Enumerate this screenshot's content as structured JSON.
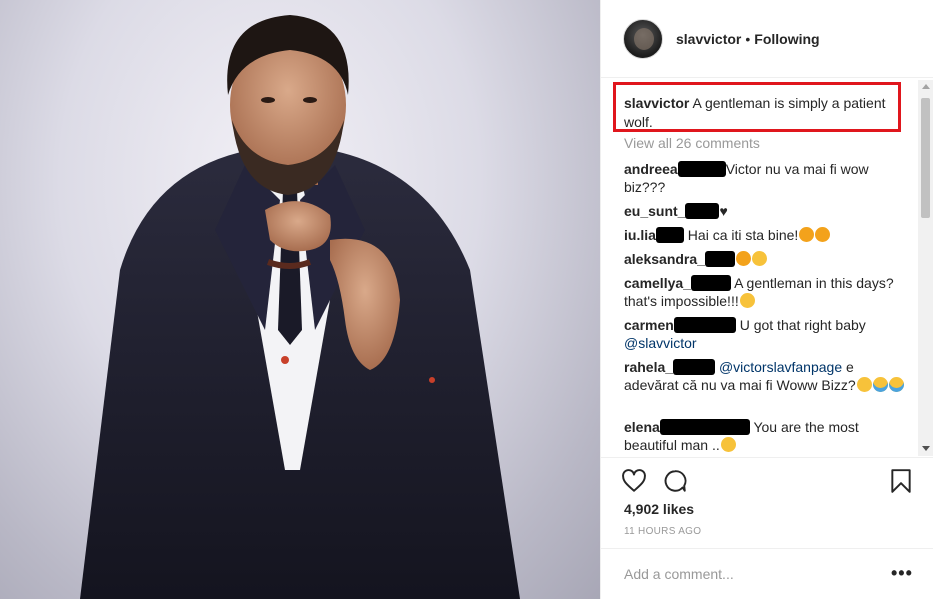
{
  "post": {
    "username": "slavvictor",
    "separator": "•",
    "follow_status": "Following"
  },
  "caption": {
    "username": "slavvictor",
    "text": "A gentleman is simply a patient wolf."
  },
  "view_all_comments": "View all 26 comments",
  "comments": [
    {
      "username": "andreea",
      "text": "Victor nu va mai fi wow biz???"
    },
    {
      "username": "eu_sunt_",
      "text": "♥"
    },
    {
      "username": "iu.lia",
      "text": "Hai ca iti sta bine!"
    },
    {
      "username": "aleksandra_",
      "text": ""
    },
    {
      "username": "camellya_",
      "text": "A gentleman in this days? that's impossible!!!"
    },
    {
      "username": "carmen",
      "text": "U got that right baby",
      "mention": "@slavvictor"
    },
    {
      "username": "rahela_",
      "mention": "@victorslavfanpage",
      "text": "e adevărat că nu va mai fi Woww Bizz?"
    },
    {
      "username": "elena",
      "text": "You are the most beautiful man .."
    }
  ],
  "likes": "4,902 likes",
  "timestamp": "11 HOURS AGO",
  "add_comment": {
    "placeholder": "Add a comment..."
  },
  "more_options": "•••",
  "icons": {
    "like": "heart-icon",
    "comment": "comment-bubble-icon",
    "save": "bookmark-icon"
  },
  "colors": {
    "highlight_border": "#e0161d",
    "link": "#003569",
    "muted": "#999999"
  }
}
